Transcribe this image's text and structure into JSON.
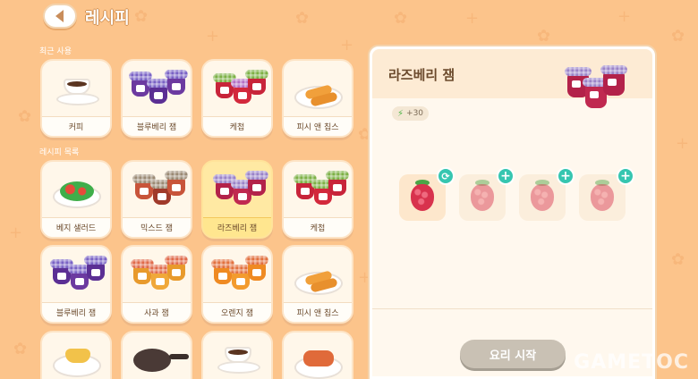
{
  "header": {
    "title": "레시피",
    "back_icon": "back-arrow-icon"
  },
  "sections": {
    "recent_label": "최근 사용",
    "list_label": "레시피 목록"
  },
  "recent": [
    {
      "label": "커피",
      "icon": "coffee-icon"
    },
    {
      "label": "블루베리 잼",
      "icon": "blueberry-jam-icon"
    },
    {
      "label": "케첩",
      "icon": "ketchup-icon"
    },
    {
      "label": "피시 앤 칩스",
      "icon": "fish-and-chips-icon"
    }
  ],
  "recipes": [
    {
      "label": "베지 샐러드",
      "icon": "veggie-salad-icon"
    },
    {
      "label": "믹스드 잼",
      "icon": "mixed-jam-icon"
    },
    {
      "label": "라즈베리 잼",
      "icon": "raspberry-jam-icon",
      "selected": true
    },
    {
      "label": "케첩",
      "icon": "ketchup-icon"
    },
    {
      "label": "블루베리 잼",
      "icon": "blueberry-jam-icon"
    },
    {
      "label": "사과 잼",
      "icon": "apple-jam-icon"
    },
    {
      "label": "오렌지 잼",
      "icon": "orange-jam-icon"
    },
    {
      "label": "피시 앤 칩스",
      "icon": "fish-and-chips-icon"
    },
    {
      "label": "",
      "icon": "pudding-icon"
    },
    {
      "label": "",
      "icon": "skillet-icon"
    },
    {
      "label": "",
      "icon": "coffee-icon"
    },
    {
      "label": "",
      "icon": "sandwich-icon"
    }
  ],
  "detail": {
    "title": "라즈베리 잼",
    "energy": "+30",
    "energy_icon": "lightning-icon",
    "ingredients": [
      {
        "icon": "raspberry-icon",
        "badge": "swap-icon",
        "filled": true
      },
      {
        "icon": "raspberry-icon",
        "badge": "plus-icon",
        "filled": false
      },
      {
        "icon": "raspberry-icon",
        "badge": "plus-icon",
        "filled": false
      },
      {
        "icon": "raspberry-icon",
        "badge": "plus-icon",
        "filled": false
      }
    ],
    "cook_label": "요리 시작"
  },
  "watermark": "GAMETOC",
  "colors": {
    "background": "#fcc48b",
    "selected": "#ffe68f",
    "badge": "#36c6b0",
    "cook_button_disabled": "#c9c1b4"
  }
}
